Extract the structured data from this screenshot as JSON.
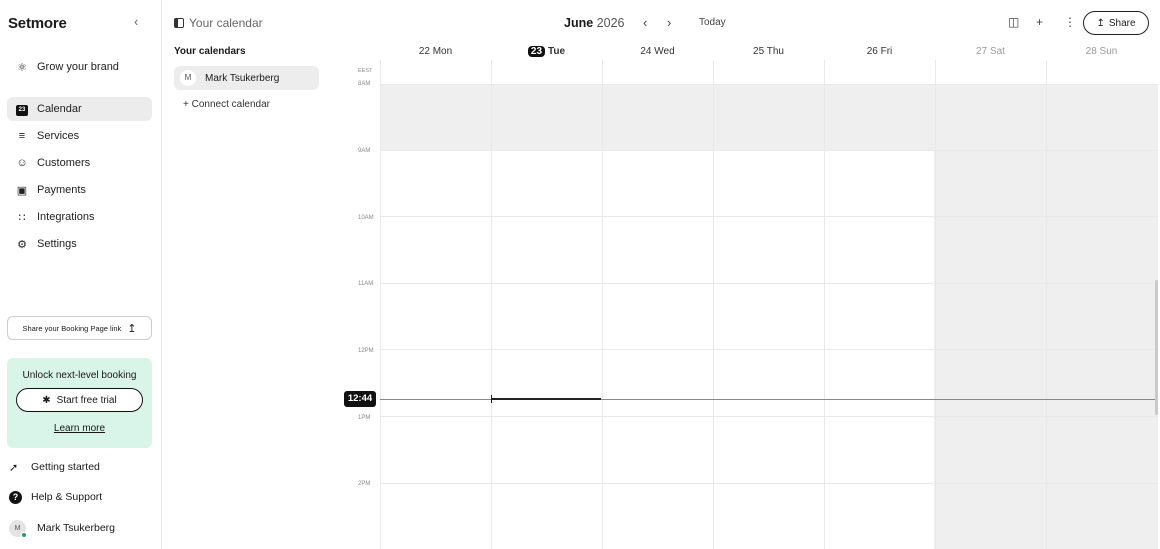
{
  "sidebar": {
    "brand": "Setmore",
    "collapse_icon": "chevron-left-icon",
    "grow_brand": "Grow your brand",
    "nav": [
      {
        "label": "Calendar",
        "icon": "calendar-icon",
        "badge": "23",
        "active": true
      },
      {
        "label": "Services",
        "icon": "list-icon"
      },
      {
        "label": "Customers",
        "icon": "smile-icon"
      },
      {
        "label": "Payments",
        "icon": "payment-icon"
      },
      {
        "label": "Integrations",
        "icon": "integrations-icon"
      },
      {
        "label": "Settings",
        "icon": "gear-icon"
      }
    ],
    "share_booking": "Share your Booking Page link",
    "promo": {
      "title": "Unlock next-level booking",
      "trial_button": "Start free trial",
      "learn_more": "Learn more",
      "bg_color": "#d9f4e8"
    },
    "getting_started": "Getting started",
    "help": "Help & Support",
    "user": {
      "name": "Mark Tsukerberg",
      "initial": "M"
    }
  },
  "panel": {
    "header": "Your calendar",
    "title": "Your calendars",
    "calendar_entry": {
      "initial": "M",
      "name": "Mark Tsukerberg"
    },
    "connect": "+ Connect calendar"
  },
  "topbar": {
    "month": "June",
    "year": "2026",
    "today": "Today",
    "share": "Share"
  },
  "calendar": {
    "timezone": "EEST",
    "days": [
      {
        "num": "22",
        "name": "Mon"
      },
      {
        "num": "23",
        "name": "Tue",
        "today": true
      },
      {
        "num": "24",
        "name": "Wed"
      },
      {
        "num": "25",
        "name": "Thu"
      },
      {
        "num": "26",
        "name": "Fri"
      },
      {
        "num": "27",
        "name": "Sat",
        "weekend": true
      },
      {
        "num": "28",
        "name": "Sun",
        "weekend": true
      }
    ],
    "hours": [
      "8AM",
      "9AM",
      "10AM",
      "11AM",
      "12PM",
      "1PM",
      "2PM"
    ],
    "current_time": "12:44"
  }
}
